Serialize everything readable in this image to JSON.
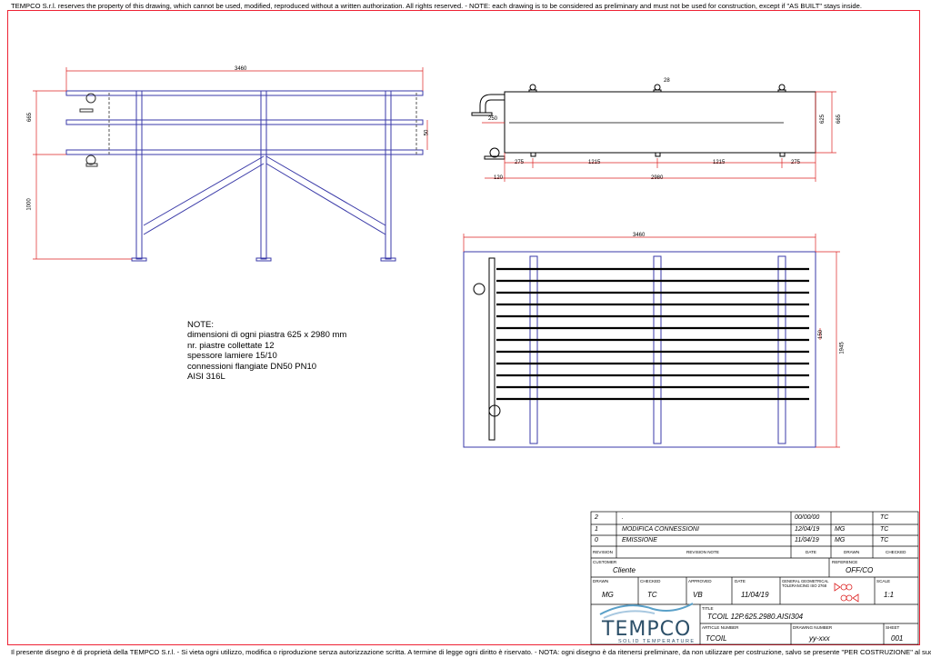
{
  "top_note": "TEMPCO S.r.l. reserves the property of this drawing, which cannot be used, modified, reproduced without a written authorization. All rights reserved. - NOTE: each drawing is to be considered as preliminary and must not be used for construction, except if \"AS BUILT\" stays inside.",
  "bottom_note": "Il presente disegno è di proprietà della TEMPCO S.r.l. - Si vieta ogni utilizzo, modifica o riproduzione senza autorizzazione scritta. A termine di legge ogni diritto è riservato. - NOTA: ogni disegno è da ritenersi preliminare, da non utilizzare per costruzione, salvo se presente \"PER COSTRUZIONE\" al suo interno.",
  "notes": {
    "title": "NOTE:",
    "lines": [
      "dimensioni di ogni piastra 625 x 2980 mm",
      "nr. piastre collettate 12",
      "spessore lamiere 15/10",
      "connessioni flangiate DN50 PN10",
      "AISI 316L"
    ]
  },
  "dims": {
    "front_width": "3460",
    "front_h1": "665",
    "front_h2": "1000",
    "front_50": "50",
    "side_28": "28",
    "side_250": "250",
    "side_625": "625",
    "side_665": "665",
    "side_275a": "275",
    "side_1215a": "1215",
    "side_1215b": "1215",
    "side_275b": "275",
    "side_120": "120",
    "side_2980": "2980",
    "plan_width": "3460",
    "plan_150": "150",
    "plan_1945": "1945"
  },
  "title_block": {
    "revisions": [
      {
        "rev": "2",
        "note": ".",
        "date": "00/00/00",
        "drawn": "",
        "checked": "TC"
      },
      {
        "rev": "1",
        "note": "MODIFICA CONNESSIONI",
        "date": "12/04/19",
        "drawn": "MG",
        "checked": "TC"
      },
      {
        "rev": "0",
        "note": "EMISSIONE",
        "date": "11/04/19",
        "drawn": "MG",
        "checked": "TC"
      }
    ],
    "headers": {
      "revision": "REVISION",
      "revision_note": "REVISION NOTE",
      "date": "DATE",
      "drawn": "DRAWN",
      "checked": "CHECKED"
    },
    "customer_label": "CUSTOMER",
    "customer": "Cliente",
    "reference_label": "REFERENCE",
    "reference": "OFF/CO",
    "drawn_label": "DRAWN",
    "drawn": "MG",
    "checked_label": "CHECKED",
    "checked": "TC",
    "approved_label": "APPROVED",
    "approved": "VB",
    "date_label": "DATE",
    "date": "11/04/19",
    "tolerance_label": "GENERAL GEOMETRICAL TOLERANCING ISO 2768",
    "scale_label": "SCALE",
    "scale": "1:1",
    "title_label": "TITLE",
    "title": "TCOIL 12P.625.2980.AISI304",
    "article_label": "ARTICLE NUMBER",
    "article": "TCOIL",
    "drawing_label": "DRAWING NUMBER",
    "drawing": "yy-xxx",
    "sheet_label": "SHEET",
    "sheet": "001"
  },
  "logo": {
    "word": "TEMPCO",
    "sub": "SOLID TEMPERATURE"
  },
  "colors": {
    "frame": "#e02233",
    "structure": "#3a3aa8",
    "dim": "#d22",
    "plate": "#000"
  }
}
